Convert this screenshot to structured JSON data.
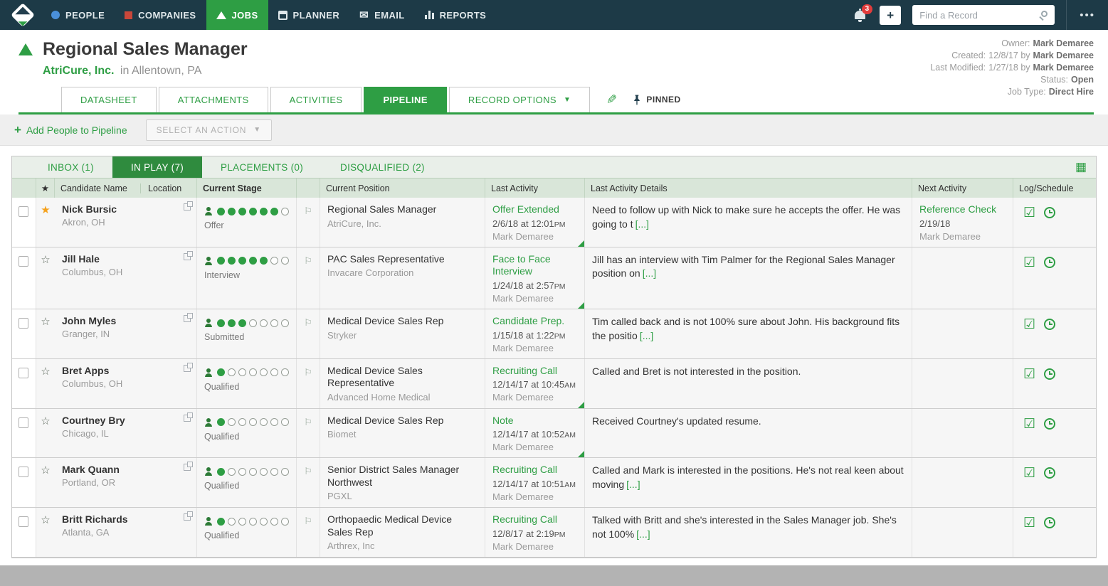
{
  "topnav": {
    "items": [
      {
        "label": "PEOPLE",
        "icon": "people-icon"
      },
      {
        "label": "COMPANIES",
        "icon": "companies-icon"
      },
      {
        "label": "JOBS",
        "icon": "jobs-icon",
        "active": true
      },
      {
        "label": "PLANNER",
        "icon": "planner-icon"
      },
      {
        "label": "EMAIL",
        "icon": "email-icon"
      },
      {
        "label": "REPORTS",
        "icon": "reports-icon"
      }
    ],
    "notification_count": "3",
    "quick_add_label": "+",
    "search_placeholder": "Find a Record",
    "icons": [
      "app-logo",
      "bell-icon",
      "search-icon",
      "ellipsis-icon"
    ]
  },
  "record_header": {
    "title": "Regional Sales Manager",
    "company": "AtriCure, Inc.",
    "company_location": "in Allentown, PA",
    "meta": [
      {
        "label": "Owner:",
        "text": "",
        "strong": "Mark Demaree"
      },
      {
        "label": "Created:",
        "text": "12/8/17 by",
        "strong": "Mark Demaree"
      },
      {
        "label": "Last Modified:",
        "text": "1/27/18 by",
        "strong": "Mark Demaree"
      },
      {
        "label": "Status:",
        "text": "",
        "strong": "Open"
      },
      {
        "label": "Job Type:",
        "text": "",
        "strong": "Direct Hire"
      }
    ],
    "tabs": [
      {
        "label": "DATASHEET"
      },
      {
        "label": "ATTACHMENTS"
      },
      {
        "label": "ACTIVITIES"
      },
      {
        "label": "PIPELINE",
        "active": true
      },
      {
        "label": "RECORD OPTIONS",
        "has_dropdown": true
      }
    ],
    "pinned_label": "PINNED",
    "icons": [
      "job-triangle-icon",
      "pencil-icon",
      "pushpin-icon"
    ]
  },
  "actionbar": {
    "add_people_label": "Add People to Pipeline",
    "select_action_label": "SELECT AN ACTION"
  },
  "pipeline": {
    "tabs": [
      {
        "label": "INBOX (1)"
      },
      {
        "label": "IN PLAY (7)",
        "active": true
      },
      {
        "label": "PLACEMENTS (0)"
      },
      {
        "label": "DISQUALIFIED (2)"
      }
    ],
    "grid_view_icon": "grid-view-icon",
    "table_header": {
      "star": "★",
      "candidate": "Candidate Name",
      "location": "Location",
      "stage": "Current Stage",
      "position": "Current Position",
      "last_activity": "Last Activity",
      "last_activity_details": "Last Activity Details",
      "next_activity": "Next Activity",
      "log_schedule": "Log/Schedule"
    },
    "stage_total": 7,
    "row_icons": [
      "open-record-icon",
      "person-icon",
      "flag-icon",
      "log-activity-icon",
      "schedule-clock-icon"
    ],
    "rows": [
      {
        "starred": true,
        "name": "Nick Bursic",
        "location": "Akron, OH",
        "stage": "Offer",
        "stage_step": 6,
        "position": "Regional Sales Manager",
        "company": "AtriCure, Inc.",
        "activity": "Offer Extended",
        "activity_date": "2/6/18 at 12:01PM",
        "activity_by": "Mark Demaree",
        "details": "Need to follow up with Nick to make sure he accepts the offer. He was going to t",
        "details_more": "[...]",
        "next_activity": "Reference Check",
        "next_date": "2/19/18",
        "next_by": "Mark Demaree",
        "more_indicator": true
      },
      {
        "starred": false,
        "name": "Jill Hale",
        "location": "Columbus, OH",
        "stage": "Interview",
        "stage_step": 5,
        "position": "PAC Sales Representative",
        "company": "Invacare Corporation",
        "activity": "Face to Face Interview",
        "activity_date": "1/24/18 at 2:57PM",
        "activity_by": "Mark Demaree",
        "details": "Jill has an interview with Tim Palmer for the Regional Sales Manager position on",
        "details_more": "[...]",
        "next_activity": "",
        "next_date": "",
        "next_by": "",
        "more_indicator": true
      },
      {
        "starred": false,
        "name": "John Myles",
        "location": "Granger, IN",
        "stage": "Submitted",
        "stage_step": 3,
        "position": "Medical Device Sales Rep",
        "company": "Stryker",
        "activity": "Candidate Prep.",
        "activity_date": "1/15/18 at 1:22PM",
        "activity_by": "Mark Demaree",
        "details": "Tim called back and is not 100% sure about John. His background fits the positio",
        "details_more": "[...]",
        "next_activity": "",
        "next_date": "",
        "next_by": "",
        "more_indicator": false
      },
      {
        "starred": false,
        "name": "Bret Apps",
        "location": "Columbus, OH",
        "stage": "Qualified",
        "stage_step": 1,
        "position": "Medical Device Sales Representative",
        "company": "Advanced Home Medical",
        "activity": "Recruiting Call",
        "activity_date": "12/14/17 at 10:45AM",
        "activity_by": "Mark Demaree",
        "details": "Called and Bret is not interested in the position.",
        "details_more": "",
        "next_activity": "",
        "next_date": "",
        "next_by": "",
        "more_indicator": true
      },
      {
        "starred": false,
        "name": "Courtney Bry",
        "location": "Chicago, IL",
        "stage": "Qualified",
        "stage_step": 1,
        "position": "Medical Device Sales Rep",
        "company": "Biomet",
        "activity": "Note",
        "activity_date": "12/14/17 at 10:52AM",
        "activity_by": "Mark Demaree",
        "details": "Received Courtney's updated resume.",
        "details_more": "",
        "next_activity": "",
        "next_date": "",
        "next_by": "",
        "more_indicator": true
      },
      {
        "starred": false,
        "name": "Mark Quann",
        "location": "Portland, OR",
        "stage": "Qualified",
        "stage_step": 1,
        "position": "Senior District Sales Manager Northwest",
        "company": "PGXL",
        "activity": "Recruiting Call",
        "activity_date": "12/14/17 at 10:51AM",
        "activity_by": "Mark Demaree",
        "details": "Called and Mark is interested in the positions. He's not real keen about moving",
        "details_more": "[...]",
        "next_activity": "",
        "next_date": "",
        "next_by": "",
        "more_indicator": false
      },
      {
        "starred": false,
        "name": "Britt Richards",
        "location": "Atlanta, GA",
        "stage": "Qualified",
        "stage_step": 1,
        "position": "Orthopaedic Medical Device Sales Rep",
        "company": "Arthrex, Inc",
        "activity": "Recruiting Call",
        "activity_date": "12/8/17 at 2:19PM",
        "activity_by": "Mark Demaree",
        "details": "Talked with Britt and she's interested in the Sales Manager job. She's not 100%",
        "details_more": "[...]",
        "next_activity": "",
        "next_date": "",
        "next_by": "",
        "more_indicator": false
      }
    ]
  }
}
